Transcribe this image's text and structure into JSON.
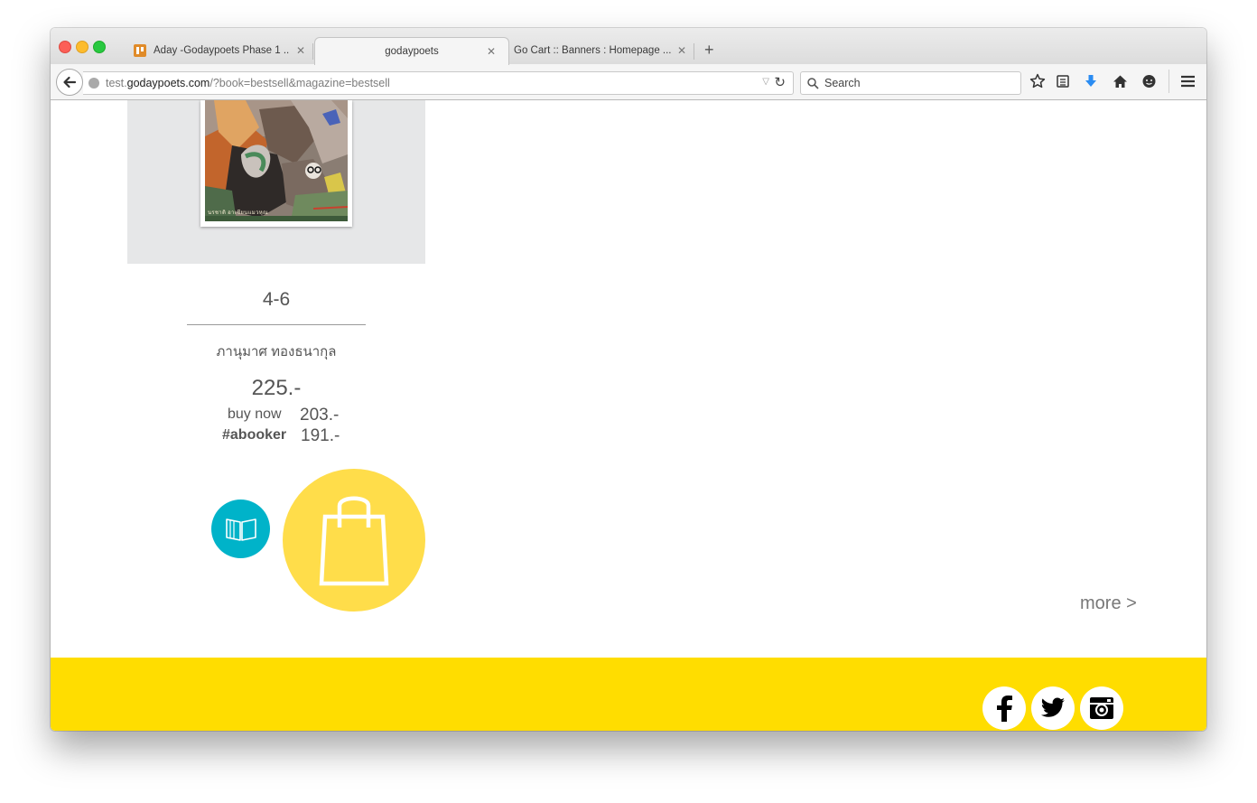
{
  "browser": {
    "tabs": [
      {
        "title": "Aday -Godaypoets Phase 1 ...",
        "icon": "trello-icon",
        "active": false
      },
      {
        "title": "godaypoets",
        "active": true
      },
      {
        "title": "Go Cart :: Banners : Homepage ...",
        "active": false
      }
    ],
    "url": {
      "prefix": "test.",
      "host": "godaypoets.com",
      "path": "/?book=bestsell&magazine=bestsell"
    },
    "search_placeholder": "Search"
  },
  "product": {
    "cover_caption": "นรชาติ อาเซียนแมวหุณ",
    "title": "4-6",
    "author": "ภานุมาศ ทองธนากุล",
    "price": "225.-",
    "buy_now_label": "buy now",
    "buy_now_price": "203.-",
    "abooker_label": "#abooker",
    "abooker_price": "191.-"
  },
  "actions": {
    "preview_icon": "open-book-icon",
    "cart_icon": "shopping-bag-icon",
    "preview_color": "#00b3c9",
    "cart_color": "#ffdd4a"
  },
  "more_label": "more >",
  "footer": {
    "color": "#ffdd00",
    "social": [
      "facebook-icon",
      "twitter-icon",
      "instagram-icon"
    ]
  }
}
